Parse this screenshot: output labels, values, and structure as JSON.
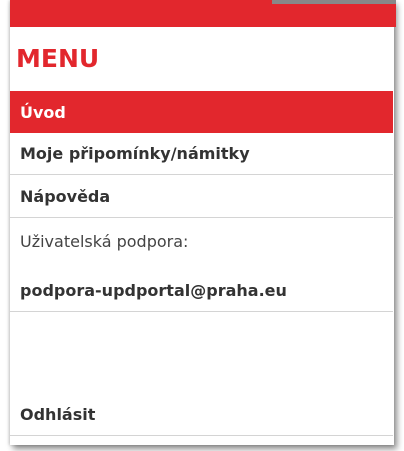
{
  "menu": {
    "title": "MENU",
    "items": [
      {
        "label": "Úvod"
      },
      {
        "label": "Moje připomínky/námitky"
      },
      {
        "label": "Nápověda"
      }
    ],
    "support_label": "Uživatelská podpora:",
    "support_email": "podpora-updportal@praha.eu",
    "logout_label": "Odhlásit"
  },
  "colors": {
    "accent": "#e2272d",
    "text": "#333333",
    "divider": "#d4d4d4"
  }
}
